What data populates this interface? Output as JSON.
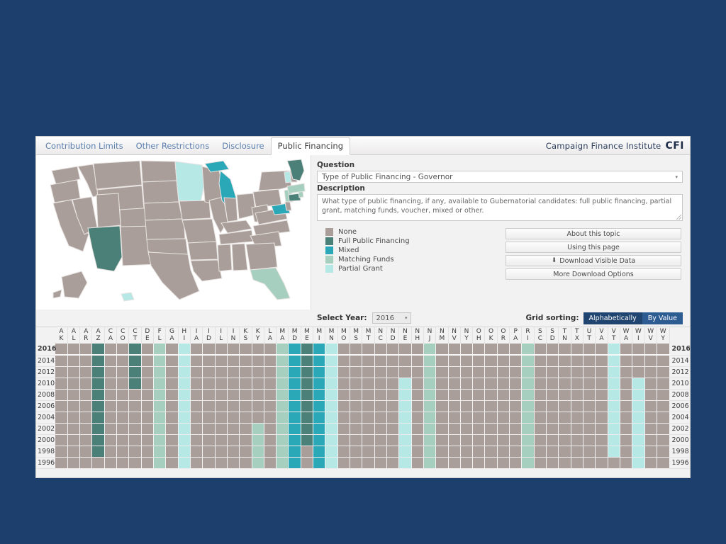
{
  "header": {
    "tabs": [
      {
        "label": "Contribution Limits",
        "active": false
      },
      {
        "label": "Other Restrictions",
        "active": false
      },
      {
        "label": "Disclosure",
        "active": false
      },
      {
        "label": "Public Financing",
        "active": true
      }
    ],
    "brand_name": "Campaign Finance Institute",
    "brand_abbr": "CFI"
  },
  "panel": {
    "question_label": "Question",
    "question_value": "Type of Public Financing - Governor",
    "description_label": "Description",
    "description_value": "What type of public financing, if any, available to Gubernatorial candidates:  full public financing, partial grant, matching funds, voucher, mixed or other.",
    "caret": "▾"
  },
  "legend": [
    {
      "label": "None",
      "color": "#aa9e9a"
    },
    {
      "label": "Full Public Financing",
      "color": "#4b8079"
    },
    {
      "label": "Mixed",
      "color": "#2ba8b8"
    },
    {
      "label": "Matching Funds",
      "color": "#a6cfc0"
    },
    {
      "label": "Partial Grant",
      "color": "#b6e8e6"
    }
  ],
  "buttons": [
    {
      "label": "About this topic",
      "icon": ""
    },
    {
      "label": "Using this page",
      "icon": ""
    },
    {
      "label": "Download Visible Data",
      "icon": "download-icon"
    },
    {
      "label": "More Download Options",
      "icon": ""
    }
  ],
  "controls": {
    "select_year_label": "Select Year:",
    "selected_year": "2016",
    "grid_sorting_label": "Grid sorting:",
    "sort_alphabetically": "Alphabetically",
    "sort_by_value": "By Value",
    "active_sort": "Alphabetically"
  },
  "chart_data": {
    "type": "heatmap",
    "title": "Type of Public Financing - Governor",
    "xlabel": "State",
    "ylabel": "Year",
    "legend_position": "left",
    "categories_x": [
      "AK",
      "AL",
      "AR",
      "AZ",
      "CA",
      "CO",
      "CT",
      "DE",
      "FL",
      "GA",
      "HI",
      "IA",
      "ID",
      "IL",
      "IN",
      "KS",
      "KY",
      "LA",
      "MA",
      "MD",
      "ME",
      "MI",
      "MN",
      "MO",
      "MS",
      "MT",
      "NC",
      "ND",
      "NE",
      "NH",
      "NJ",
      "NM",
      "NV",
      "NY",
      "OH",
      "OK",
      "OR",
      "PA",
      "RI",
      "SC",
      "SD",
      "TN",
      "TX",
      "UT",
      "VA",
      "VT",
      "WA",
      "WI",
      "WV",
      "WY"
    ],
    "categories_y": [
      "2016",
      "2014",
      "2012",
      "2010",
      "2008",
      "2006",
      "2004",
      "2002",
      "2000",
      "1998",
      "1996"
    ],
    "value_colors": {
      "None": "#aa9e9a",
      "Full Public Financing": "#4b8079",
      "Mixed": "#2ba8b8",
      "Matching Funds": "#a6cfc0",
      "Partial Grant": "#b6e8e6"
    },
    "rows": [
      {
        "year": "2016",
        "values": [
          "None",
          "None",
          "None",
          "Full Public Financing",
          "None",
          "None",
          "Full Public Financing",
          "None",
          "Matching Funds",
          "None",
          "Partial Grant",
          "None",
          "None",
          "None",
          "None",
          "None",
          "None",
          "None",
          "Matching Funds",
          "Mixed",
          "Full Public Financing",
          "Mixed",
          "Partial Grant",
          "None",
          "None",
          "None",
          "None",
          "None",
          "None",
          "None",
          "Matching Funds",
          "None",
          "None",
          "None",
          "None",
          "None",
          "None",
          "None",
          "Matching Funds",
          "None",
          "None",
          "None",
          "None",
          "None",
          "None",
          "Partial Grant",
          "None",
          "None",
          "None",
          "None"
        ]
      },
      {
        "year": "2014",
        "values": [
          "None",
          "None",
          "None",
          "Full Public Financing",
          "None",
          "None",
          "Full Public Financing",
          "None",
          "Matching Funds",
          "None",
          "Partial Grant",
          "None",
          "None",
          "None",
          "None",
          "None",
          "None",
          "None",
          "Matching Funds",
          "Mixed",
          "Full Public Financing",
          "Mixed",
          "Partial Grant",
          "None",
          "None",
          "None",
          "None",
          "None",
          "None",
          "None",
          "Matching Funds",
          "None",
          "None",
          "None",
          "None",
          "None",
          "None",
          "None",
          "Matching Funds",
          "None",
          "None",
          "None",
          "None",
          "None",
          "None",
          "Partial Grant",
          "None",
          "None",
          "None",
          "None"
        ]
      },
      {
        "year": "2012",
        "values": [
          "None",
          "None",
          "None",
          "Full Public Financing",
          "None",
          "None",
          "Full Public Financing",
          "None",
          "Matching Funds",
          "None",
          "Partial Grant",
          "None",
          "None",
          "None",
          "None",
          "None",
          "None",
          "None",
          "Matching Funds",
          "Mixed",
          "Full Public Financing",
          "Mixed",
          "Partial Grant",
          "None",
          "None",
          "None",
          "None",
          "None",
          "None",
          "None",
          "Matching Funds",
          "None",
          "None",
          "None",
          "None",
          "None",
          "None",
          "None",
          "Matching Funds",
          "None",
          "None",
          "None",
          "None",
          "None",
          "None",
          "Partial Grant",
          "None",
          "None",
          "None",
          "None"
        ]
      },
      {
        "year": "2010",
        "values": [
          "None",
          "None",
          "None",
          "Full Public Financing",
          "None",
          "None",
          "Full Public Financing",
          "None",
          "Matching Funds",
          "None",
          "Partial Grant",
          "None",
          "None",
          "None",
          "None",
          "None",
          "None",
          "None",
          "Matching Funds",
          "Mixed",
          "Full Public Financing",
          "Mixed",
          "Partial Grant",
          "None",
          "None",
          "None",
          "None",
          "None",
          "Partial Grant",
          "None",
          "Matching Funds",
          "None",
          "None",
          "None",
          "None",
          "None",
          "None",
          "None",
          "Matching Funds",
          "None",
          "None",
          "None",
          "None",
          "None",
          "None",
          "Partial Grant",
          "None",
          "Partial Grant",
          "None",
          "None"
        ]
      },
      {
        "year": "2008",
        "values": [
          "None",
          "None",
          "None",
          "Full Public Financing",
          "None",
          "None",
          "None",
          "None",
          "Matching Funds",
          "None",
          "Partial Grant",
          "None",
          "None",
          "None",
          "None",
          "None",
          "None",
          "None",
          "Matching Funds",
          "Mixed",
          "Full Public Financing",
          "Mixed",
          "Partial Grant",
          "None",
          "None",
          "None",
          "None",
          "None",
          "Partial Grant",
          "None",
          "Matching Funds",
          "None",
          "None",
          "None",
          "None",
          "None",
          "None",
          "None",
          "Matching Funds",
          "None",
          "None",
          "None",
          "None",
          "None",
          "None",
          "Partial Grant",
          "None",
          "Partial Grant",
          "None",
          "None"
        ]
      },
      {
        "year": "2006",
        "values": [
          "None",
          "None",
          "None",
          "Full Public Financing",
          "None",
          "None",
          "None",
          "None",
          "Matching Funds",
          "None",
          "Partial Grant",
          "None",
          "None",
          "None",
          "None",
          "None",
          "None",
          "None",
          "Matching Funds",
          "Mixed",
          "Full Public Financing",
          "Mixed",
          "Partial Grant",
          "None",
          "None",
          "None",
          "None",
          "None",
          "Partial Grant",
          "None",
          "Matching Funds",
          "None",
          "None",
          "None",
          "None",
          "None",
          "None",
          "None",
          "Matching Funds",
          "None",
          "None",
          "None",
          "None",
          "None",
          "None",
          "Partial Grant",
          "None",
          "Partial Grant",
          "None",
          "None"
        ]
      },
      {
        "year": "2004",
        "values": [
          "None",
          "None",
          "None",
          "Full Public Financing",
          "None",
          "None",
          "None",
          "None",
          "Matching Funds",
          "None",
          "Partial Grant",
          "None",
          "None",
          "None",
          "None",
          "None",
          "None",
          "None",
          "Matching Funds",
          "Mixed",
          "Full Public Financing",
          "Mixed",
          "Partial Grant",
          "None",
          "None",
          "None",
          "None",
          "None",
          "Partial Grant",
          "None",
          "Matching Funds",
          "None",
          "None",
          "None",
          "None",
          "None",
          "None",
          "None",
          "Matching Funds",
          "None",
          "None",
          "None",
          "None",
          "None",
          "None",
          "Partial Grant",
          "None",
          "Partial Grant",
          "None",
          "None"
        ]
      },
      {
        "year": "2002",
        "values": [
          "None",
          "None",
          "None",
          "Full Public Financing",
          "None",
          "None",
          "None",
          "None",
          "Matching Funds",
          "None",
          "Partial Grant",
          "None",
          "None",
          "None",
          "None",
          "None",
          "Matching Funds",
          "None",
          "Matching Funds",
          "Mixed",
          "Full Public Financing",
          "Mixed",
          "Partial Grant",
          "None",
          "None",
          "None",
          "None",
          "None",
          "Partial Grant",
          "None",
          "Matching Funds",
          "None",
          "None",
          "None",
          "None",
          "None",
          "None",
          "None",
          "Matching Funds",
          "None",
          "None",
          "None",
          "None",
          "None",
          "None",
          "Partial Grant",
          "None",
          "Partial Grant",
          "None",
          "None"
        ]
      },
      {
        "year": "2000",
        "values": [
          "None",
          "None",
          "None",
          "Full Public Financing",
          "None",
          "None",
          "None",
          "None",
          "Matching Funds",
          "None",
          "Partial Grant",
          "None",
          "None",
          "None",
          "None",
          "None",
          "Matching Funds",
          "None",
          "Matching Funds",
          "Mixed",
          "Full Public Financing",
          "Mixed",
          "Partial Grant",
          "None",
          "None",
          "None",
          "None",
          "None",
          "Partial Grant",
          "None",
          "Matching Funds",
          "None",
          "None",
          "None",
          "None",
          "None",
          "None",
          "None",
          "Matching Funds",
          "None",
          "None",
          "None",
          "None",
          "None",
          "None",
          "Partial Grant",
          "None",
          "Partial Grant",
          "None",
          "None"
        ]
      },
      {
        "year": "1998",
        "values": [
          "None",
          "None",
          "None",
          "Full Public Financing",
          "None",
          "None",
          "None",
          "None",
          "Matching Funds",
          "None",
          "Partial Grant",
          "None",
          "None",
          "None",
          "None",
          "None",
          "Matching Funds",
          "None",
          "Matching Funds",
          "Mixed",
          "None",
          "Mixed",
          "Partial Grant",
          "None",
          "None",
          "None",
          "None",
          "None",
          "Partial Grant",
          "None",
          "Matching Funds",
          "None",
          "None",
          "None",
          "None",
          "None",
          "None",
          "None",
          "Matching Funds",
          "None",
          "None",
          "None",
          "None",
          "None",
          "None",
          "Partial Grant",
          "None",
          "Partial Grant",
          "None",
          "None"
        ]
      },
      {
        "year": "1996",
        "values": [
          "None",
          "None",
          "None",
          "None",
          "None",
          "None",
          "None",
          "None",
          "Matching Funds",
          "None",
          "Partial Grant",
          "None",
          "None",
          "None",
          "None",
          "None",
          "Matching Funds",
          "None",
          "Matching Funds",
          "Mixed",
          "None",
          "Mixed",
          "Partial Grant",
          "None",
          "None",
          "None",
          "None",
          "None",
          "Partial Grant",
          "None",
          "Matching Funds",
          "None",
          "None",
          "None",
          "None",
          "None",
          "None",
          "None",
          "Matching Funds",
          "None",
          "None",
          "None",
          "None",
          "None",
          "None",
          "None",
          "None",
          "Partial Grant",
          "None",
          "None"
        ]
      }
    ]
  },
  "map": {
    "name": "us-choropleth-map",
    "highlighted": {
      "AZ": "Full Public Financing",
      "ME": "Full Public Financing",
      "CT": "Full Public Financing",
      "MI": "Mixed",
      "MD": "Mixed",
      "MN": "Partial Grant",
      "VT": "Partial Grant",
      "WI": "Partial Grant",
      "HI": "Partial Grant",
      "FL": "Matching Funds",
      "NJ": "Matching Funds",
      "MA": "Matching Funds",
      "RI": "Matching Funds"
    }
  }
}
